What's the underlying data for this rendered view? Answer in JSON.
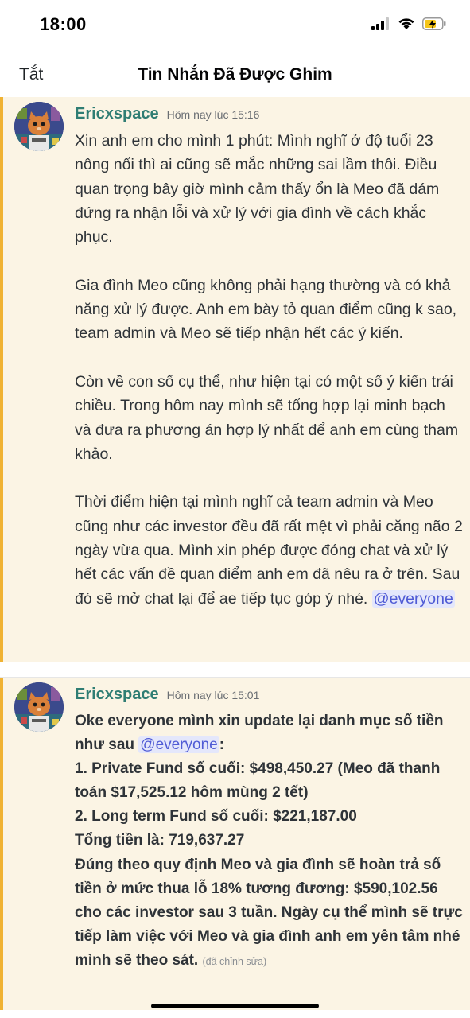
{
  "status_bar": {
    "time": "18:00",
    "signal_icon": "cellular-signal-icon",
    "wifi_icon": "wifi-icon",
    "battery_icon": "battery-charging-icon"
  },
  "nav": {
    "close_label": "Tắt",
    "title": "Tin Nhắn Đã Được Ghim"
  },
  "colors": {
    "pinned_background": "#fbf4e4",
    "pinned_border": "#f0b232",
    "author": "#2f7d73",
    "mention_bg": "#e4e7fb",
    "mention_text": "#4f5bd5"
  },
  "messages": [
    {
      "author": "Ericxspace",
      "timestamp": "Hôm nay lúc 15:16",
      "paragraphs": [
        "Xin anh em cho mình 1 phút: Mình nghĩ ở độ tuổi 23 nông nổi thì ai cũng sẽ mắc những sai lầm thôi. Điều quan trọng bây giờ mình cảm thấy ổn là Meo đã dám đứng ra nhận lỗi và xử lý với gia đình về cách khắc phục.",
        "Gia đình Meo cũng không phải hạng thường và có khả năng xử lý được. Anh em bày tỏ quan điểm cũng k sao, team admin và Meo sẽ tiếp nhận hết các ý kiến.",
        "Còn về con số cụ thể, như hiện tại có một số ý kiến trái chiều. Trong hôm nay mình sẽ tổng hợp lại minh bạch và đưa ra phương án hợp lý nhất để anh em cùng tham khảo.",
        "Thời điểm hiện tại mình nghĩ cả team admin và Meo cũng như các investor đều đã rất mệt vì phải căng não 2 ngày vừa qua. Mình xin phép được đóng chat và xử lý hết các vấn đề quan điểm anh em đã nêu ra ở trên. Sau đó sẽ mở chat lại để ae tiếp tục góp ý nhé."
      ],
      "mention": "@everyone"
    },
    {
      "author": "Ericxspace",
      "timestamp": "Hôm nay lúc 15:01",
      "intro": "Oke everyone mình xin update lại danh mục số tiền như sau",
      "mention": "@everyone",
      "intro_suffix": ":",
      "lines": [
        "1. Private Fund số cuối: $498,450.27 (Meo đã thanh toán $17,525.12 hôm mùng 2 tết)",
        "2. Long term Fund số cuối: $221,187.00",
        "Tổng tiền là: 719,637.27",
        "Đúng theo quy định Meo và gia đình sẽ hoàn trả số tiền ở mức thua lỗ 18% tương đương: $590,102.56 cho các investor sau 3 tuần. Ngày cụ thể mình sẽ trực tiếp làm việc với Meo và gia đình anh em yên tâm nhé mình sẽ theo sát."
      ],
      "edited_label": "(đã chỉnh sửa)"
    }
  ]
}
